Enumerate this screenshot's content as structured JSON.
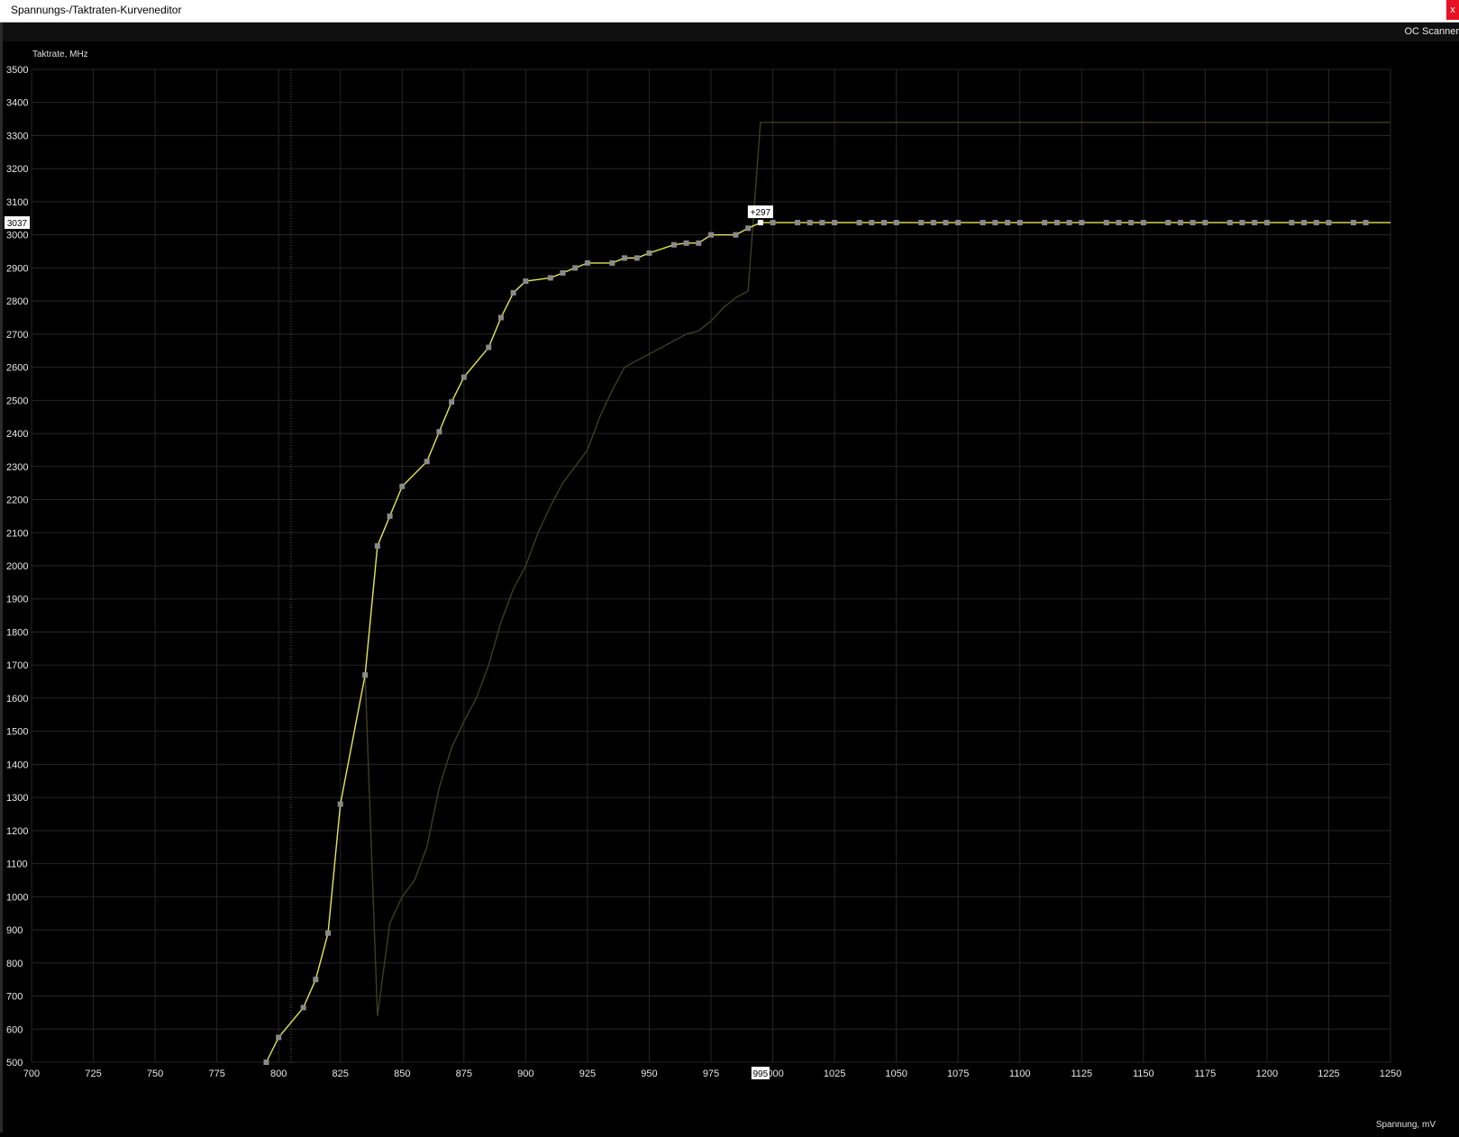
{
  "window": {
    "title": "Spannungs-/Taktraten-Kurveneditor",
    "close_label": "x"
  },
  "toolbar": {
    "oc_scanner_label": "OC Scanner"
  },
  "chart_data": {
    "type": "line",
    "ylabel": "Taktrate, MHz",
    "xlabel": "Spannung, mV",
    "xlim": [
      700,
      1250
    ],
    "ylim": [
      500,
      3500
    ],
    "x_ticks": [
      700,
      725,
      750,
      775,
      800,
      825,
      850,
      875,
      900,
      925,
      950,
      975,
      1000,
      1025,
      1050,
      1075,
      1100,
      1125,
      1150,
      1175,
      1200,
      1225,
      1250
    ],
    "y_ticks": [
      500,
      600,
      700,
      800,
      900,
      1000,
      1100,
      1200,
      1300,
      1400,
      1500,
      1600,
      1700,
      1800,
      1900,
      2000,
      2100,
      2200,
      2300,
      2400,
      2500,
      2600,
      2700,
      2800,
      2900,
      3000,
      3100,
      3200,
      3300,
      3400,
      3500
    ],
    "grid": true,
    "dotted_marker_x": 805,
    "series": [
      {
        "color": "#e6e656",
        "points": [
          [
            795,
            500
          ],
          [
            800,
            575
          ],
          [
            810,
            665
          ],
          [
            815,
            750
          ],
          [
            820,
            890
          ],
          [
            825,
            1280
          ],
          [
            835,
            1670
          ],
          [
            840,
            2060
          ],
          [
            845,
            2150
          ],
          [
            850,
            2240
          ],
          [
            860,
            2315
          ],
          [
            865,
            2405
          ],
          [
            870,
            2495
          ],
          [
            875,
            2570
          ],
          [
            885,
            2660
          ],
          [
            890,
            2750
          ],
          [
            895,
            2825
          ],
          [
            900,
            2860
          ],
          [
            910,
            2870
          ],
          [
            915,
            2885
          ],
          [
            920,
            2900
          ],
          [
            925,
            2915
          ],
          [
            935,
            2915
          ],
          [
            940,
            2930
          ],
          [
            945,
            2930
          ],
          [
            950,
            2945
          ],
          [
            960,
            2970
          ],
          [
            965,
            2975
          ],
          [
            970,
            2975
          ],
          [
            975,
            3000
          ],
          [
            985,
            3000
          ],
          [
            990,
            3020
          ],
          [
            995,
            3037
          ],
          [
            1000,
            3037
          ],
          [
            1010,
            3037
          ],
          [
            1015,
            3037
          ],
          [
            1020,
            3037
          ],
          [
            1025,
            3037
          ],
          [
            1035,
            3037
          ],
          [
            1040,
            3037
          ],
          [
            1045,
            3037
          ],
          [
            1050,
            3037
          ],
          [
            1060,
            3037
          ],
          [
            1065,
            3037
          ],
          [
            1070,
            3037
          ],
          [
            1075,
            3037
          ],
          [
            1085,
            3037
          ],
          [
            1090,
            3037
          ],
          [
            1095,
            3037
          ],
          [
            1100,
            3037
          ],
          [
            1110,
            3037
          ],
          [
            1115,
            3037
          ],
          [
            1120,
            3037
          ],
          [
            1125,
            3037
          ],
          [
            1135,
            3037
          ],
          [
            1140,
            3037
          ],
          [
            1145,
            3037
          ],
          [
            1150,
            3037
          ],
          [
            1160,
            3037
          ],
          [
            1165,
            3037
          ],
          [
            1170,
            3037
          ],
          [
            1175,
            3037
          ],
          [
            1185,
            3037
          ],
          [
            1190,
            3037
          ],
          [
            1195,
            3037
          ],
          [
            1200,
            3037
          ],
          [
            1210,
            3037
          ],
          [
            1215,
            3037
          ],
          [
            1220,
            3037
          ],
          [
            1225,
            3037
          ],
          [
            1235,
            3037
          ],
          [
            1240,
            3037
          ],
          [
            1250,
            3037
          ]
        ],
        "markers": [
          [
            795,
            500
          ],
          [
            800,
            575
          ],
          [
            810,
            665
          ],
          [
            815,
            750
          ],
          [
            820,
            890
          ],
          [
            825,
            1280
          ],
          [
            835,
            1670
          ],
          [
            840,
            2060
          ],
          [
            845,
            2150
          ],
          [
            850,
            2240
          ],
          [
            860,
            2315
          ],
          [
            865,
            2405
          ],
          [
            870,
            2495
          ],
          [
            875,
            2570
          ],
          [
            885,
            2660
          ],
          [
            890,
            2750
          ],
          [
            895,
            2825
          ],
          [
            900,
            2860
          ],
          [
            910,
            2870
          ],
          [
            915,
            2885
          ],
          [
            920,
            2900
          ],
          [
            925,
            2915
          ],
          [
            935,
            2915
          ],
          [
            940,
            2930
          ],
          [
            945,
            2930
          ],
          [
            950,
            2945
          ],
          [
            960,
            2970
          ],
          [
            965,
            2975
          ],
          [
            970,
            2975
          ],
          [
            975,
            3000
          ],
          [
            985,
            3000
          ],
          [
            990,
            3020
          ],
          [
            1000,
            3037
          ],
          [
            1010,
            3037
          ],
          [
            1015,
            3037
          ],
          [
            1020,
            3037
          ],
          [
            1025,
            3037
          ],
          [
            1035,
            3037
          ],
          [
            1040,
            3037
          ],
          [
            1045,
            3037
          ],
          [
            1050,
            3037
          ],
          [
            1060,
            3037
          ],
          [
            1065,
            3037
          ],
          [
            1070,
            3037
          ],
          [
            1075,
            3037
          ],
          [
            1085,
            3037
          ],
          [
            1090,
            3037
          ],
          [
            1095,
            3037
          ],
          [
            1100,
            3037
          ],
          [
            1110,
            3037
          ],
          [
            1115,
            3037
          ],
          [
            1120,
            3037
          ],
          [
            1125,
            3037
          ],
          [
            1135,
            3037
          ],
          [
            1140,
            3037
          ],
          [
            1145,
            3037
          ],
          [
            1150,
            3037
          ],
          [
            1160,
            3037
          ],
          [
            1165,
            3037
          ],
          [
            1170,
            3037
          ],
          [
            1175,
            3037
          ],
          [
            1185,
            3037
          ],
          [
            1190,
            3037
          ],
          [
            1195,
            3037
          ],
          [
            1200,
            3037
          ],
          [
            1210,
            3037
          ],
          [
            1215,
            3037
          ],
          [
            1220,
            3037
          ],
          [
            1225,
            3037
          ],
          [
            1235,
            3037
          ],
          [
            1240,
            3037
          ]
        ]
      },
      {
        "color": "#3e3e22",
        "points": [
          [
            835,
            1670
          ],
          [
            840,
            640
          ],
          [
            845,
            920
          ],
          [
            850,
            1000
          ],
          [
            855,
            1050
          ],
          [
            860,
            1150
          ],
          [
            865,
            1330
          ],
          [
            870,
            1450
          ],
          [
            875,
            1530
          ],
          [
            880,
            1600
          ],
          [
            885,
            1700
          ],
          [
            890,
            1830
          ],
          [
            895,
            1930
          ],
          [
            900,
            2000
          ],
          [
            905,
            2100
          ],
          [
            910,
            2180
          ],
          [
            915,
            2250
          ],
          [
            920,
            2300
          ],
          [
            925,
            2350
          ],
          [
            930,
            2450
          ],
          [
            935,
            2530
          ],
          [
            940,
            2600
          ],
          [
            945,
            2620
          ],
          [
            950,
            2640
          ],
          [
            955,
            2660
          ],
          [
            960,
            2680
          ],
          [
            965,
            2700
          ],
          [
            970,
            2710
          ],
          [
            975,
            2740
          ],
          [
            980,
            2780
          ],
          [
            985,
            2810
          ],
          [
            990,
            2830
          ],
          [
            995,
            3340
          ],
          [
            1250,
            3340
          ]
        ]
      }
    ],
    "selected_point": {
      "x": 995,
      "y": 3037,
      "offset_label": "+297",
      "y_readout": "3037",
      "x_readout": "995"
    }
  }
}
